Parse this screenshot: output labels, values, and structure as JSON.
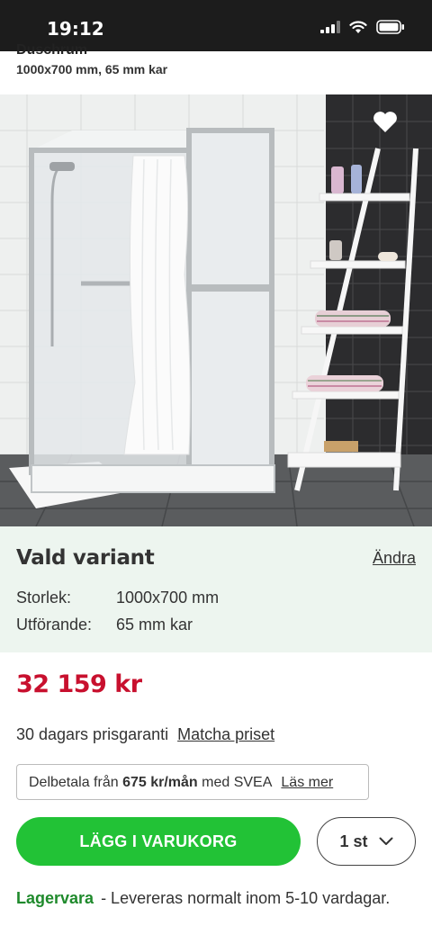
{
  "status_bar": {
    "time": "19:12"
  },
  "product": {
    "name_clipped": "Duschrum",
    "subtitle": "1000x700 mm, 65 mm kar"
  },
  "variant": {
    "title": "Vald variant",
    "change_link": "Ändra",
    "rows": [
      {
        "label": "Storlek:",
        "value": "1000x700 mm"
      },
      {
        "label": "Utförande:",
        "value": "65 mm kar"
      }
    ]
  },
  "price": "32 159 kr",
  "guarantee": {
    "text": "30 dagars prisgaranti",
    "link": "Matcha priset"
  },
  "installment": {
    "prefix": "Delbetala från",
    "amount": "675 kr/mån",
    "suffix": "med SVEA",
    "link": "Läs mer"
  },
  "cart": {
    "add_button": "LÄGG I VARUKORG",
    "quantity": "1 st"
  },
  "stock": {
    "status": "Lagervara",
    "text": "- Levereras normalt inom 5-10 vardagar."
  },
  "icons": [
    "signal-icon",
    "wifi-icon",
    "battery-icon",
    "heart-icon",
    "chevron-down-icon"
  ],
  "colors": {
    "price": "#c8102e",
    "add_button": "#22c236",
    "in_stock": "#1f8a2c",
    "variant_bg": "#edf5ef"
  }
}
